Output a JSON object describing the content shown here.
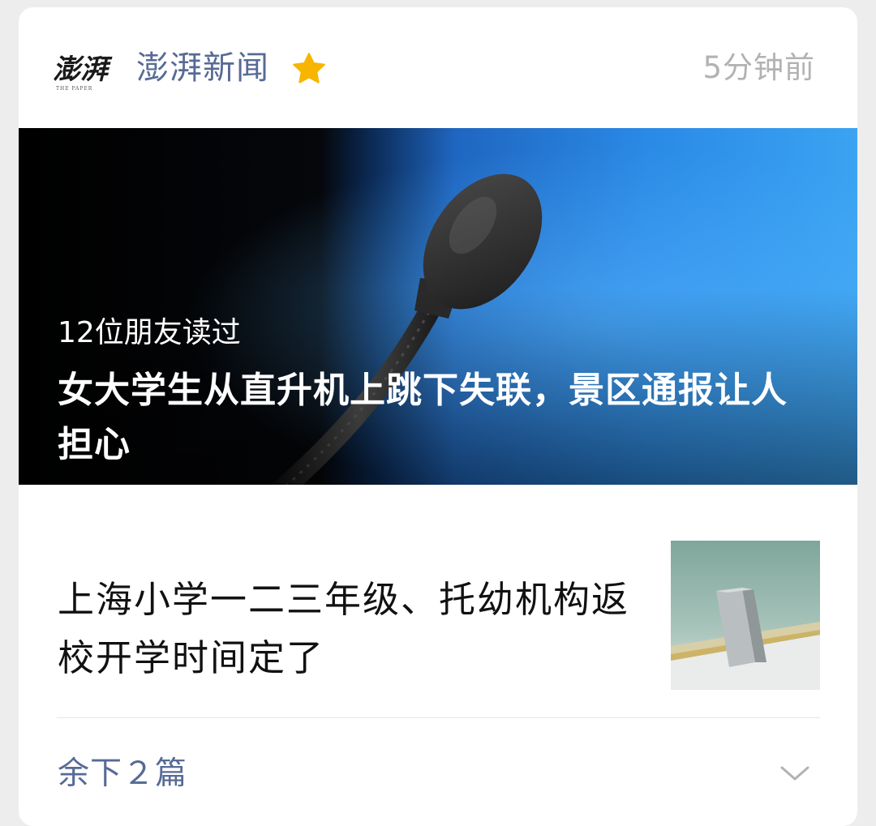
{
  "header": {
    "logo_text": "澎湃",
    "logo_subtext": "THE PAPER",
    "source_name": "澎湃新闻",
    "starred_icon": "star-icon",
    "timestamp": "5分钟前"
  },
  "hero": {
    "read_count": "12位朋友读过",
    "title": "女大学生从直升机上跳下失联，景区通报让人担心",
    "image": "microphone-photo"
  },
  "article2": {
    "title": "上海小学一二三年级、托幼机构返校开学时间定了",
    "image": "chalkboard-eraser-photo"
  },
  "footer": {
    "more_label": "余下２篇",
    "expand_icon": "chevron-down-icon"
  },
  "colors": {
    "link_blue": "#576b95",
    "timestamp_gray": "#b2b2b2",
    "star_yellow": "#f7b500"
  }
}
